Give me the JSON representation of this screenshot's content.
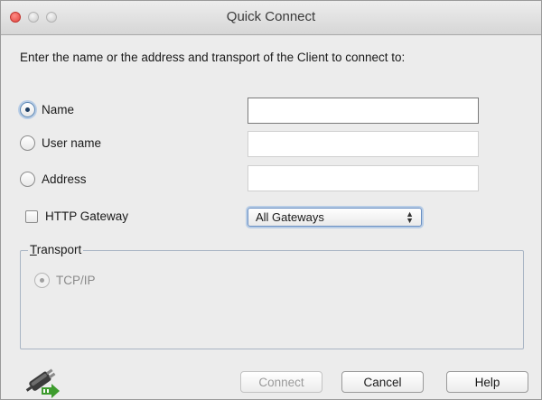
{
  "window": {
    "title": "Quick Connect"
  },
  "prompt": "Enter the name or the address and transport of the Client to connect to:",
  "options": {
    "name_label": "Name",
    "username_label": "User name",
    "address_label": "Address",
    "selected": "name"
  },
  "fields": {
    "name_value": "",
    "username_value": "",
    "address_value": ""
  },
  "gateway": {
    "checkbox_label": "HTTP Gateway",
    "checked": false,
    "selected": "All Gateways"
  },
  "transport": {
    "group_label_first": "T",
    "group_label_rest": "ransport",
    "tcpip_label": "TCP/IP"
  },
  "buttons": {
    "connect": "Connect",
    "cancel": "Cancel",
    "help": "Help"
  },
  "icons": {
    "footer_icon": "plug-connect-icon"
  }
}
